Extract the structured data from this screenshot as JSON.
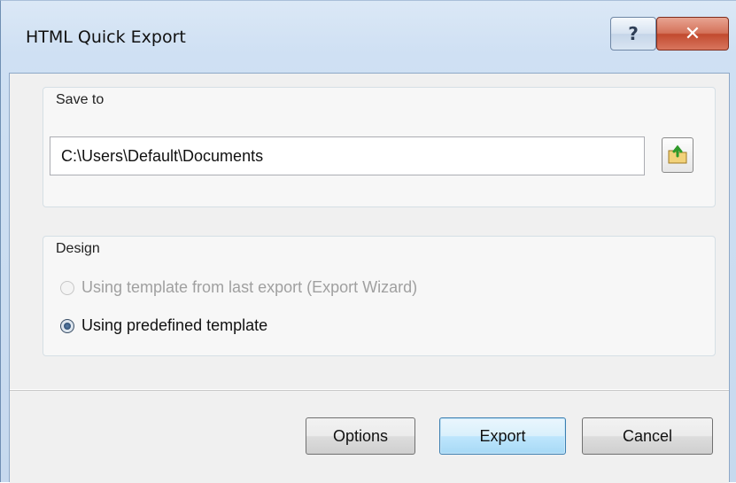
{
  "window": {
    "title": "HTML Quick Export",
    "help_glyph": "?",
    "close_glyph": "✕"
  },
  "save_to": {
    "label": "Save to",
    "path_value": "C:\\Users\\Default\\Documents",
    "browse_icon": "folder-up-arrow-icon"
  },
  "design": {
    "label": "Design",
    "options": [
      {
        "label": "Using template from last export (Export Wizard)",
        "state": "disabled"
      },
      {
        "label": "Using predefined template",
        "state": "selected"
      }
    ]
  },
  "buttons": {
    "options": "Options",
    "export": "Export",
    "cancel": "Cancel"
  },
  "colors": {
    "close_button": "#c24a2f",
    "default_button_border": "#3c7fb1"
  }
}
